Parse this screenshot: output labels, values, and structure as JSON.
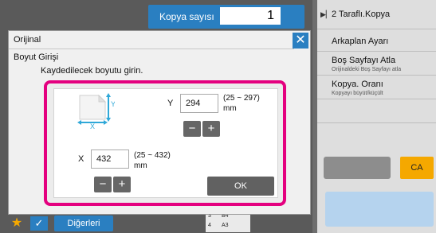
{
  "copy_bar": {
    "label": "Kopya sayısı",
    "count": "1"
  },
  "right_panel": {
    "items": [
      {
        "main": "2 Taraflı.Kopya",
        "sub": ""
      },
      {
        "main": "Arkaplan Ayarı",
        "sub": ""
      },
      {
        "main": "Boş Sayfayı Atla",
        "sub": "Orijinaldeki Boş Sayfayı atla"
      },
      {
        "main": "Kopya. Oranı",
        "sub": "Kopyayı büyüt/küçült"
      }
    ],
    "ca_label": "CA"
  },
  "bottom_bar": {
    "other_label": "Diğerleri",
    "paper_top": "B4",
    "paper_bottom": "A3",
    "tray1": "3",
    "tray2": "4"
  },
  "dialog": {
    "title": "Orijinal",
    "subtitle": "Boyut Girişi",
    "message": "Kaydedilecek boyutu girin.",
    "y": {
      "label": "Y",
      "value": "294",
      "range": "(25 ~ 297)",
      "unit": "mm"
    },
    "x": {
      "label": "X",
      "value": "432",
      "range": "(25 ~ 432)",
      "unit": "mm"
    },
    "ok_label": "OK",
    "close_symbol": "✕",
    "minus_symbol": "−",
    "plus_symbol": "+"
  },
  "colors": {
    "accent": "#2a7fc1",
    "highlight": "#e4007f",
    "ca": "#f5a800"
  }
}
